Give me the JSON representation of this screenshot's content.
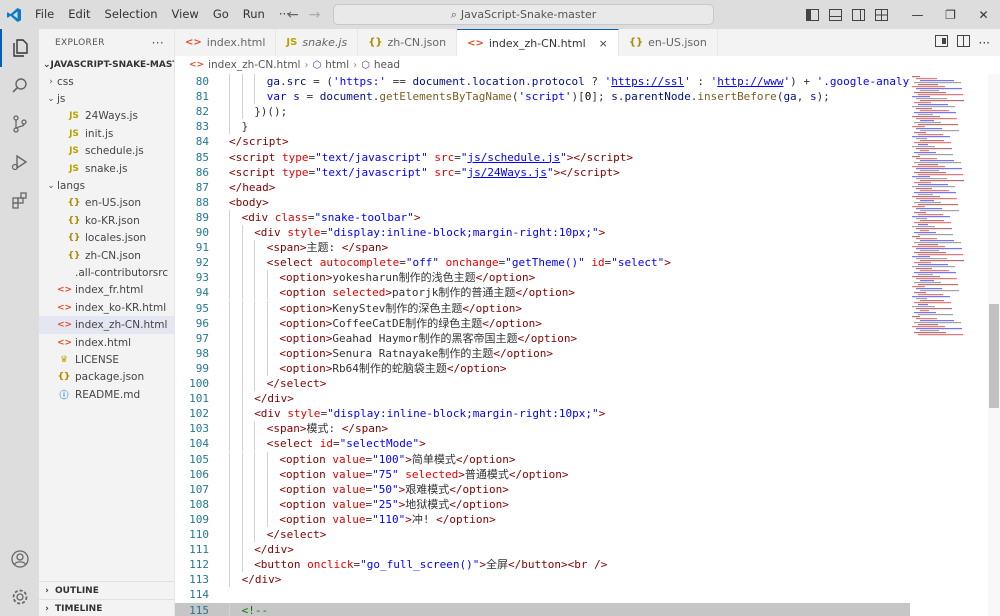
{
  "menu": [
    "File",
    "Edit",
    "Selection",
    "View",
    "Go",
    "Run",
    "···"
  ],
  "search": {
    "text": "JavaScript-Snake-master"
  },
  "sidebar": {
    "header": "EXPLORER",
    "more": "···",
    "root": "JAVASCRIPT-SNAKE-MAST...",
    "items": [
      {
        "label": "css",
        "type": "folder",
        "expanded": false,
        "depth": 1
      },
      {
        "label": "js",
        "type": "folder",
        "expanded": true,
        "depth": 1
      },
      {
        "label": "24Ways.js",
        "type": "js",
        "depth": 2
      },
      {
        "label": "init.js",
        "type": "js",
        "depth": 2
      },
      {
        "label": "schedule.js",
        "type": "js",
        "depth": 2
      },
      {
        "label": "snake.js",
        "type": "js",
        "depth": 2
      },
      {
        "label": "langs",
        "type": "folder",
        "expanded": true,
        "depth": 1
      },
      {
        "label": "en-US.json",
        "type": "json",
        "depth": 2
      },
      {
        "label": "ko-KR.json",
        "type": "json",
        "depth": 2
      },
      {
        "label": "locales.json",
        "type": "json",
        "depth": 2
      },
      {
        "label": "zh-CN.json",
        "type": "json",
        "depth": 2
      },
      {
        "label": ".all-contributorsrc",
        "type": "rc",
        "depth": 1
      },
      {
        "label": "index_fr.html",
        "type": "html",
        "depth": 1
      },
      {
        "label": "index_ko-KR.html",
        "type": "html",
        "depth": 1
      },
      {
        "label": "index_zh-CN.html",
        "type": "html",
        "depth": 1,
        "selected": true
      },
      {
        "label": "index.html",
        "type": "html",
        "depth": 1
      },
      {
        "label": "LICENSE",
        "type": "license",
        "depth": 1
      },
      {
        "label": "package.json",
        "type": "json",
        "depth": 1
      },
      {
        "label": "README.md",
        "type": "info",
        "depth": 1
      }
    ],
    "outline": "OUTLINE",
    "timeline": "TIMELINE"
  },
  "tabs": [
    {
      "label": "index.html",
      "icon": "<>",
      "active": false,
      "italic": false
    },
    {
      "label": "snake.js",
      "icon": "JS",
      "active": false,
      "italic": true
    },
    {
      "label": "zh-CN.json",
      "icon": "{}",
      "active": false,
      "italic": false
    },
    {
      "label": "index_zh-CN.html",
      "icon": "<>",
      "active": true,
      "italic": false,
      "close": "×"
    },
    {
      "label": "en-US.json",
      "icon": "{}",
      "active": false,
      "italic": false
    }
  ],
  "breadcrumb": [
    "index_zh-CN.html",
    "html",
    "head"
  ],
  "editor": {
    "lines": [
      {
        "n": "80",
        "i": 3,
        "html": "<span class='var'>ga</span>.<span class='var'>src</span> = (<span class='str'>'https:'</span> == <span class='var'>document</span>.<span class='var'>location</span>.<span class='var'>protocol</span> ? <span class='str'>'<span class=\"link\">https://ssl</span>'</span> : <span class='str'>'<span class=\"link\">http://www</span>'</span>) + <span class='str'>'.google-analytics.com/ga.js'</span>;"
      },
      {
        "n": "81",
        "i": 3,
        "html": "<span class='kw'>var</span> <span class='var'>s</span> = <span class='var'>document</span>.<span class='fn'>getElementsByTagName</span>(<span class='str'>'script'</span>)[<span class='txt'>0</span>]; <span class='var'>s</span>.<span class='var'>parentNode</span>.<span class='fn'>insertBefore</span>(<span class='var'>ga</span>, <span class='var'>s</span>);"
      },
      {
        "n": "82",
        "i": 2,
        "html": "})();"
      },
      {
        "n": "83",
        "i": 1,
        "html": "}"
      },
      {
        "n": "84",
        "i": 0,
        "html": "<span class='tag'>&lt;/script&gt;</span>"
      },
      {
        "n": "85",
        "i": 0,
        "html": "<span class='tag'>&lt;script</span> <span class='attr'>type</span>=<span class='str'>\"text/javascript\"</span> <span class='attr'>src</span>=<span class='str'>\"<span class=\"link\">js/schedule.js</span>\"</span><span class='tag'>&gt;&lt;/script&gt;</span>"
      },
      {
        "n": "86",
        "i": 0,
        "html": "<span class='tag'>&lt;script</span> <span class='attr'>type</span>=<span class='str'>\"text/javascript\"</span> <span class='attr'>src</span>=<span class='str'>\"<span class=\"link\">js/24Ways.js</span>\"</span><span class='tag'>&gt;&lt;/script&gt;</span>"
      },
      {
        "n": "87",
        "i": 0,
        "html": "<span class='tag'>&lt;/head&gt;</span>"
      },
      {
        "n": "88",
        "i": 0,
        "html": "<span class='tag'>&lt;body&gt;</span>"
      },
      {
        "n": "89",
        "i": 1,
        "html": "<span class='tag'>&lt;div</span> <span class='attr'>class</span>=<span class='str'>\"snake-toolbar\"</span><span class='tag'>&gt;</span>"
      },
      {
        "n": "90",
        "i": 2,
        "html": "<span class='tag'>&lt;div</span> <span class='attr'>style</span>=<span class='str'>\"display:inline-block;margin-right:10px;\"</span><span class='tag'>&gt;</span>"
      },
      {
        "n": "91",
        "i": 3,
        "html": "<span class='tag'>&lt;span&gt;</span>主题: <span class='tag'>&lt;/span&gt;</span>"
      },
      {
        "n": "92",
        "i": 3,
        "html": "<span class='tag'>&lt;select</span> <span class='attr'>autocomplete</span>=<span class='str'>\"off\"</span> <span class='attr'>onchange</span>=<span class='str'>\"getTheme()\"</span> <span class='attr'>id</span>=<span class='str'>\"select\"</span><span class='tag'>&gt;</span>"
      },
      {
        "n": "93",
        "i": 4,
        "html": "<span class='tag'>&lt;option&gt;</span>yokesharun制作的浅色主题<span class='tag'>&lt;/option&gt;</span>"
      },
      {
        "n": "94",
        "i": 4,
        "html": "<span class='tag'>&lt;option</span> <span class='attr'>selected</span><span class='tag'>&gt;</span>patorjk制作的普通主题<span class='tag'>&lt;/option&gt;</span>"
      },
      {
        "n": "95",
        "i": 4,
        "html": "<span class='tag'>&lt;option&gt;</span>KenyStev制作的深色主题<span class='tag'>&lt;/option&gt;</span>"
      },
      {
        "n": "96",
        "i": 4,
        "html": "<span class='tag'>&lt;option&gt;</span>CoffeeCatDE制作的绿色主题<span class='tag'>&lt;/option&gt;</span>"
      },
      {
        "n": "97",
        "i": 4,
        "html": "<span class='tag'>&lt;option&gt;</span>Geahad Haymor制作的黑客帝国主题<span class='tag'>&lt;/option&gt;</span>"
      },
      {
        "n": "98",
        "i": 4,
        "html": "<span class='tag'>&lt;option&gt;</span>Senura Ratnayake制作的主题<span class='tag'>&lt;/option&gt;</span>"
      },
      {
        "n": "99",
        "i": 4,
        "html": "<span class='tag'>&lt;option&gt;</span>Rb64制作的蛇脑袋主题<span class='tag'>&lt;/option&gt;</span>"
      },
      {
        "n": "100",
        "i": 3,
        "html": "<span class='tag'>&lt;/select&gt;</span>"
      },
      {
        "n": "101",
        "i": 2,
        "html": "<span class='tag'>&lt;/div&gt;</span>"
      },
      {
        "n": "102",
        "i": 2,
        "html": "<span class='tag'>&lt;div</span> <span class='attr'>style</span>=<span class='str'>\"display:inline-block;margin-right:10px;\"</span><span class='tag'>&gt;</span>"
      },
      {
        "n": "103",
        "i": 3,
        "html": "<span class='tag'>&lt;span&gt;</span>模式: <span class='tag'>&lt;/span&gt;</span>"
      },
      {
        "n": "104",
        "i": 3,
        "html": "<span class='tag'>&lt;select</span> <span class='attr'>id</span>=<span class='str'>\"selectMode\"</span><span class='tag'>&gt;</span>"
      },
      {
        "n": "105",
        "i": 4,
        "html": "<span class='tag'>&lt;option</span> <span class='attr'>value</span>=<span class='str'>\"100\"</span><span class='tag'>&gt;</span>简单模式<span class='tag'>&lt;/option&gt;</span>"
      },
      {
        "n": "106",
        "i": 4,
        "html": "<span class='tag'>&lt;option</span> <span class='attr'>value</span>=<span class='str'>\"75\"</span> <span class='attr'>selected</span><span class='tag'>&gt;</span>普通模式<span class='tag'>&lt;/option&gt;</span>"
      },
      {
        "n": "107",
        "i": 4,
        "html": "<span class='tag'>&lt;option</span> <span class='attr'>value</span>=<span class='str'>\"50\"</span><span class='tag'>&gt;</span>艰难模式<span class='tag'>&lt;/option&gt;</span>"
      },
      {
        "n": "108",
        "i": 4,
        "html": "<span class='tag'>&lt;option</span> <span class='attr'>value</span>=<span class='str'>\"25\"</span><span class='tag'>&gt;</span>地狱模式<span class='tag'>&lt;/option&gt;</span>"
      },
      {
        "n": "109",
        "i": 4,
        "html": "<span class='tag'>&lt;option</span> <span class='attr'>value</span>=<span class='str'>\"110\"</span><span class='tag'>&gt;</span>冲! <span class='tag'>&lt;/option&gt;</span>"
      },
      {
        "n": "110",
        "i": 3,
        "html": "<span class='tag'>&lt;/select&gt;</span>"
      },
      {
        "n": "111",
        "i": 2,
        "html": "<span class='tag'>&lt;/div&gt;</span>"
      },
      {
        "n": "112",
        "i": 2,
        "html": "<span class='tag'>&lt;button</span> <span class='attr'>onclick</span>=<span class='str'>\"go_full_screen()\"</span><span class='tag'>&gt;</span>全屏<span class='tag'>&lt;/button&gt;&lt;br /&gt;</span>"
      },
      {
        "n": "113",
        "i": 1,
        "html": "<span class='tag'>&lt;/div&gt;</span>"
      },
      {
        "n": "114",
        "i": 0,
        "html": ""
      },
      {
        "n": "115",
        "i": 1,
        "html": "<span style='color:#008000'>&lt;!--</span>",
        "highlight": true
      }
    ]
  }
}
